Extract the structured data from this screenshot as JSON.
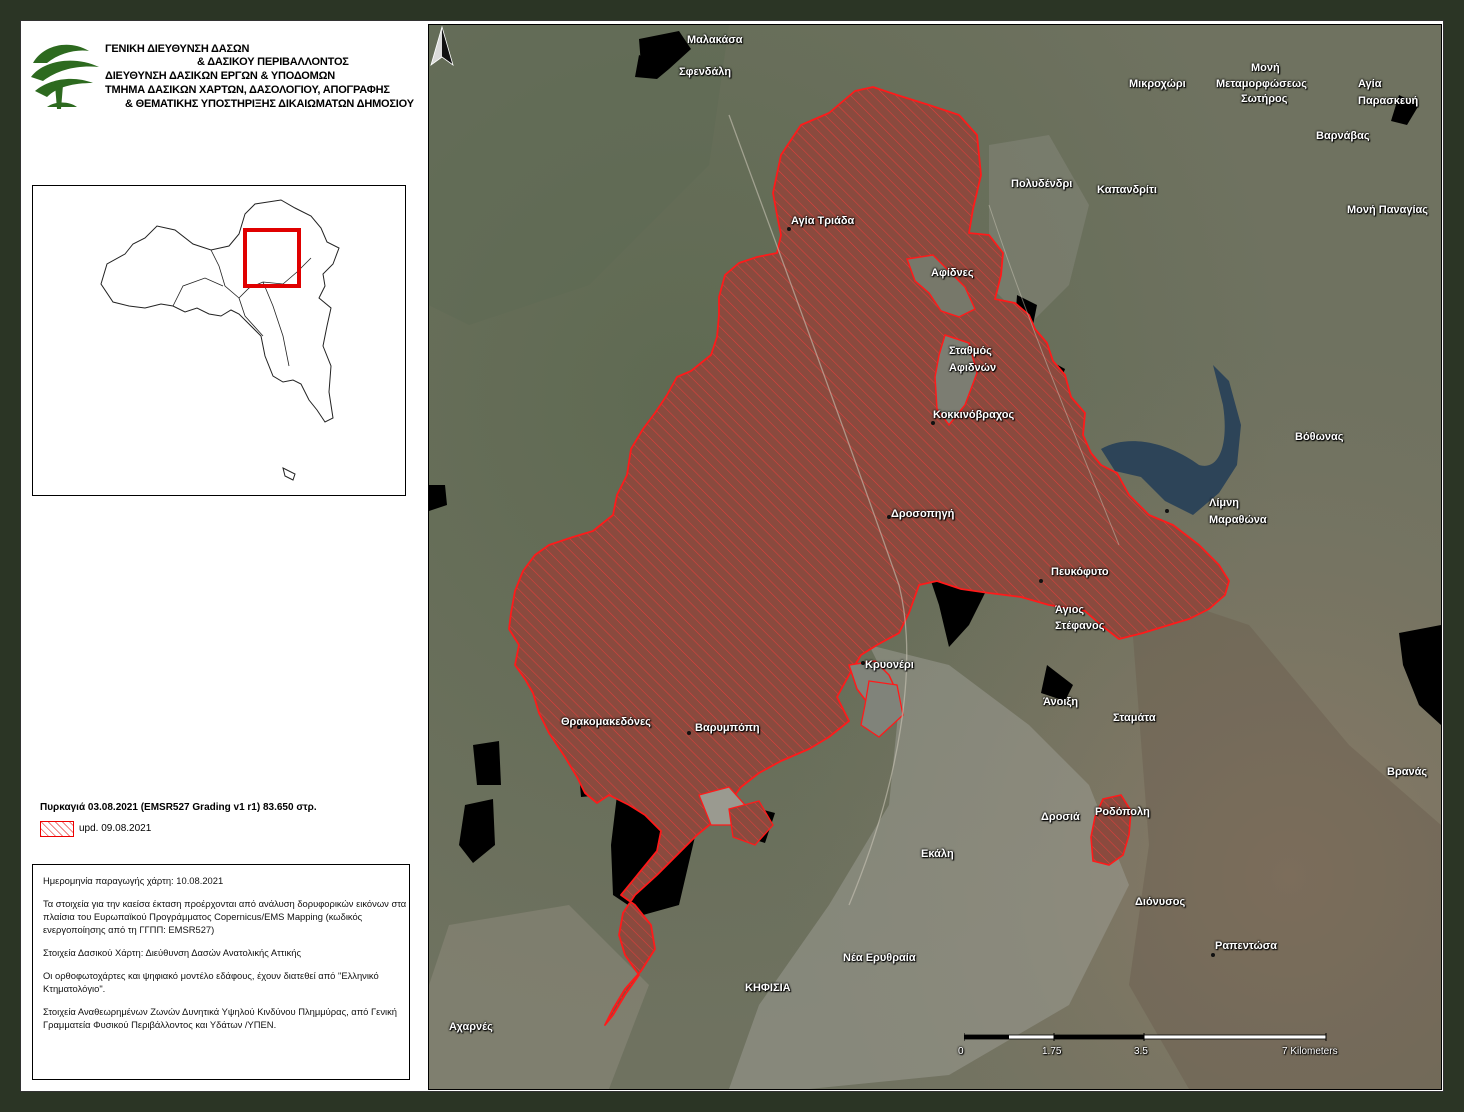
{
  "header": {
    "lines": [
      "ΓΕΝΙΚΗ ΔΙΕΥΘΥΝΣΗ ΔΑΣΩΝ",
      "& ΔΑΣΙΚΟΥ ΠΕΡΙΒΑΛΛΟΝΤΟΣ",
      "ΔΙΕΥΘΥΝΣΗ ΔΑΣΙΚΩΝ ΕΡΓΩΝ & ΥΠΟΔΟΜΩΝ",
      "ΤΜΗΜΑ ΔΑΣΙΚΩΝ ΧΑΡΤΩΝ, ΔΑΣΟΛΟΓΙΟΥ, ΑΠΟΓΡΑΦΗΣ",
      "& ΘΕΜΑΤΙΚΗΣ ΥΠΟΣΤΗΡΙΞΗΣ ΔΙΚΑΙΩΜΑΤΩΝ ΔΗΜΟΣΙΟΥ"
    ],
    "logo_icon": "forest-service-logo-icon",
    "logo_color": "#2d6a1f"
  },
  "inset_map": {
    "highlight_color": "#e00000"
  },
  "legend": {
    "title": "Πυρκαγιά 03.08.2021 (EMSR527 Grading v1 r1) 83.650 στρ.",
    "item_label": "upd. 09.08.2021",
    "burn_color": "#e00000"
  },
  "notes": {
    "production_date": "Ημερομηνία παραγωγής χάρτη: 10.08.2021",
    "source_burned": "Τα στοιχεία για την καείσα έκταση προέρχονται από ανάλυση δορυφορικών εικόνων στα πλαίσια του Ευρωπαϊκού Προγράμματος Copernicus/EMS Mapping (κωδικός ενεργοποίησης από τη ΓΓΠΠ: EMSR527)",
    "forest_map": "Στοιχεία Δασικού Χάρτη: Διεύθυνση Δασών Ανατολικής Αττικής",
    "orthophotos": "Οι ορθοφωτοχάρτες και ψηφιακό μοντέλο εδάφους, έχουν διατεθεί από \"Ελληνικό Κτηματολόγιο\".",
    "flood_zones": "Στοιχεία Αναθεωρημένων Ζωνών Δυνητικά Υψηλού Κινδύνου Πλημμύρας, από Γενική Γραμματεία Φυσικού Περιβάλλοντος και Υδάτων /ΥΠΕΝ."
  },
  "places": [
    {
      "id": "malakasa",
      "label": "Μαλακάσα"
    },
    {
      "id": "sfendali",
      "label": "Σφενδάλη"
    },
    {
      "id": "mikrochori",
      "label": "Μικροχώρι"
    },
    {
      "id": "moni-metamorfoseos-1",
      "label": "Μονή"
    },
    {
      "id": "moni-metamorfoseos-2",
      "label": "Μεταμορφώσεως"
    },
    {
      "id": "moni-metamorfoseos-3",
      "label": "Σωτήρος"
    },
    {
      "id": "agia-paraskevi-1",
      "label": "Αγία"
    },
    {
      "id": "agia-paraskevi-2",
      "label": "Παρασκευή"
    },
    {
      "id": "varnavas",
      "label": "Βαρνάβας"
    },
    {
      "id": "polydendri",
      "label": "Πολυδένδρι"
    },
    {
      "id": "kapandriti",
      "label": "Καπανδρίτι"
    },
    {
      "id": "moni-panagias",
      "label": "Μονή Παναγίας"
    },
    {
      "id": "agia-triada",
      "label": "Αγία Τριάδα"
    },
    {
      "id": "afidnes",
      "label": "Αφίδνες"
    },
    {
      "id": "stathmos-1",
      "label": "Σταθμός"
    },
    {
      "id": "stathmos-2",
      "label": "Αφιδνών"
    },
    {
      "id": "kokkinovrachos",
      "label": "Κοκκινόβραχος"
    },
    {
      "id": "bothonas",
      "label": "Βόθωνας"
    },
    {
      "id": "limni-1",
      "label": "Λίμνη"
    },
    {
      "id": "limni-2",
      "label": "Μαραθώνα"
    },
    {
      "id": "drosopigi",
      "label": "Δροσοπηγή"
    },
    {
      "id": "pefkofyto",
      "label": "Πευκόφυτο"
    },
    {
      "id": "agios-stefanos-1",
      "label": "Άγιος"
    },
    {
      "id": "agios-stefanos-2",
      "label": "Στέφανος"
    },
    {
      "id": "kryoneri",
      "label": "Κρυονέρι"
    },
    {
      "id": "anoixi",
      "label": "Άνοιξη"
    },
    {
      "id": "stamata",
      "label": "Σταμάτα"
    },
    {
      "id": "thrakomakedones",
      "label": "Θρακομακεδόνες"
    },
    {
      "id": "varympompi",
      "label": "Βαρυμπόπη"
    },
    {
      "id": "vranas",
      "label": "Βρανάς"
    },
    {
      "id": "drosia",
      "label": "Δροσιά"
    },
    {
      "id": "rodopoli",
      "label": "Ροδόπολη"
    },
    {
      "id": "ekali",
      "label": "Εκάλη"
    },
    {
      "id": "dionysos",
      "label": "Διόνυσος"
    },
    {
      "id": "rapentosa",
      "label": "Ραπεντώσα"
    },
    {
      "id": "nea-erythraia",
      "label": "Νέα Ερυθραία"
    },
    {
      "id": "kifisia",
      "label": "ΚΗΦΙΣΙΑ"
    },
    {
      "id": "acharnes",
      "label": "Αχαρνές"
    }
  ],
  "scale": {
    "ticks": [
      "0",
      "1.75",
      "3.5",
      "7 Kilometers"
    ]
  },
  "north_arrow": {
    "icon": "north-arrow-icon"
  },
  "colors": {
    "terrain": "#6f7260",
    "burn_fill": "#8a4a3e",
    "burn_outline": "#ff1a1a",
    "water": "#2d4458",
    "mask": "#000000"
  }
}
